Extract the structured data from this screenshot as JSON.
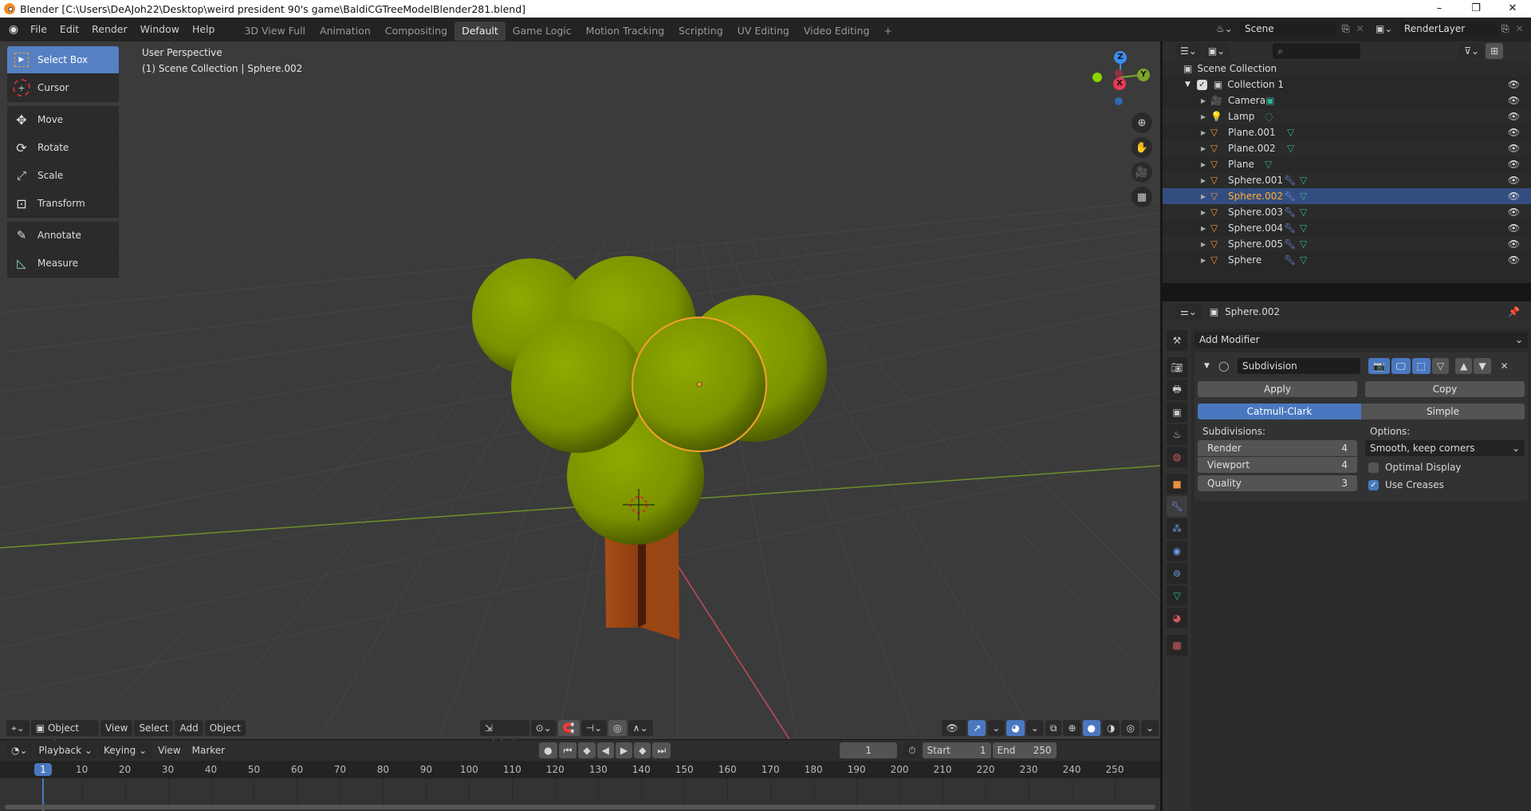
{
  "window": {
    "title": "Blender [C:\\Users\\DeAJoh22\\Desktop\\weird president 90's game\\BaldiCGTreeModelBlender281.blend]",
    "controls": [
      "–",
      "❐",
      "✕"
    ]
  },
  "topbar": {
    "menus": [
      "File",
      "Edit",
      "Render",
      "Window",
      "Help"
    ],
    "workspaces": [
      "3D View Full",
      "Animation",
      "Compositing",
      "Default",
      "Game Logic",
      "Motion Tracking",
      "Scripting",
      "UV Editing",
      "Video Editing"
    ],
    "active_workspace": "Default",
    "add_tab": "+",
    "scene": "Scene",
    "render_layer": "RenderLayer"
  },
  "viewport": {
    "perspective": "User Perspective",
    "collection_info": "(1) Scene Collection | Sphere.002",
    "tools": [
      {
        "label": "Select Box",
        "icon": "select-box-icon",
        "active": true
      },
      {
        "label": "Cursor",
        "icon": "cursor-icon"
      },
      {
        "label": "Move",
        "icon": "move-icon"
      },
      {
        "label": "Rotate",
        "icon": "rotate-icon"
      },
      {
        "label": "Scale",
        "icon": "scale-icon"
      },
      {
        "label": "Transform",
        "icon": "transform-icon"
      },
      {
        "label": "Annotate",
        "icon": "annotate-icon"
      },
      {
        "label": "Measure",
        "icon": "measure-icon"
      }
    ],
    "gizmo": {
      "z": "Z",
      "y": "Y",
      "x": "X"
    },
    "header": {
      "mode": "Object Mode",
      "menus": [
        "View",
        "Select",
        "Add",
        "Object"
      ],
      "orientation": "Global"
    },
    "colors": {
      "foliage": "#8aa300",
      "trunk": "#b0501a",
      "selection": "#f5a030",
      "x_axis": "#d24a5c",
      "y_axis": "#7ea52a"
    }
  },
  "timeline": {
    "menus": [
      "Playback",
      "Keying",
      "View",
      "Marker"
    ],
    "current_frame": "1",
    "start_label": "Start",
    "start": "1",
    "end_label": "End",
    "end": "250",
    "ruler": [
      "1",
      "10",
      "20",
      "30",
      "40",
      "50",
      "60",
      "70",
      "80",
      "90",
      "100",
      "110",
      "120",
      "130",
      "140",
      "150",
      "160",
      "170",
      "180",
      "190",
      "200",
      "210",
      "220",
      "230",
      "240",
      "250"
    ]
  },
  "outliner": {
    "search_placeholder": "",
    "root": "Scene Collection",
    "collection": "Collection 1",
    "objects": [
      {
        "name": "Camera",
        "type": "camera",
        "modifier": false,
        "data": "camera-data"
      },
      {
        "name": "Lamp",
        "type": "lamp",
        "modifier": false,
        "data": "lamp-data"
      },
      {
        "name": "Plane.001",
        "type": "mesh",
        "modifier": false,
        "data": "mesh-data"
      },
      {
        "name": "Plane.002",
        "type": "mesh",
        "modifier": false,
        "data": "mesh-data"
      },
      {
        "name": "Plane",
        "type": "mesh",
        "modifier": false,
        "data": "mesh-data"
      },
      {
        "name": "Sphere.001",
        "type": "mesh",
        "modifier": true,
        "data": "mesh-data"
      },
      {
        "name": "Sphere.002",
        "type": "mesh",
        "modifier": true,
        "data": "mesh-data",
        "selected": true
      },
      {
        "name": "Sphere.003",
        "type": "mesh",
        "modifier": true,
        "data": "mesh-data"
      },
      {
        "name": "Sphere.004",
        "type": "mesh",
        "modifier": true,
        "data": "mesh-data"
      },
      {
        "name": "Sphere.005",
        "type": "mesh",
        "modifier": true,
        "data": "mesh-data"
      },
      {
        "name": "Sphere",
        "type": "mesh",
        "modifier": true,
        "data": "mesh-data"
      }
    ]
  },
  "properties": {
    "object_name": "Sphere.002",
    "add_modifier": "Add Modifier",
    "modifier": {
      "name": "Subdivision",
      "apply": "Apply",
      "copy": "Copy",
      "types": [
        "Catmull-Clark",
        "Simple"
      ],
      "active_type": "Catmull-Clark",
      "subdivisions_label": "Subdivisions:",
      "render_label": "Render",
      "render": "4",
      "viewport_label": "Viewport",
      "viewport": "4",
      "quality_label": "Quality",
      "quality": "3",
      "options_label": "Options:",
      "uv_smooth": "Smooth, keep corners",
      "optimal_display_label": "Optimal Display",
      "optimal_display": false,
      "use_creases_label": "Use Creases",
      "use_creases": true
    },
    "tabs": [
      "tool",
      "render",
      "output",
      "view-layer",
      "scene",
      "world",
      "object",
      "modifiers",
      "particles",
      "physics",
      "constraints",
      "data",
      "material",
      "texture"
    ],
    "active_tab": "modifiers"
  }
}
